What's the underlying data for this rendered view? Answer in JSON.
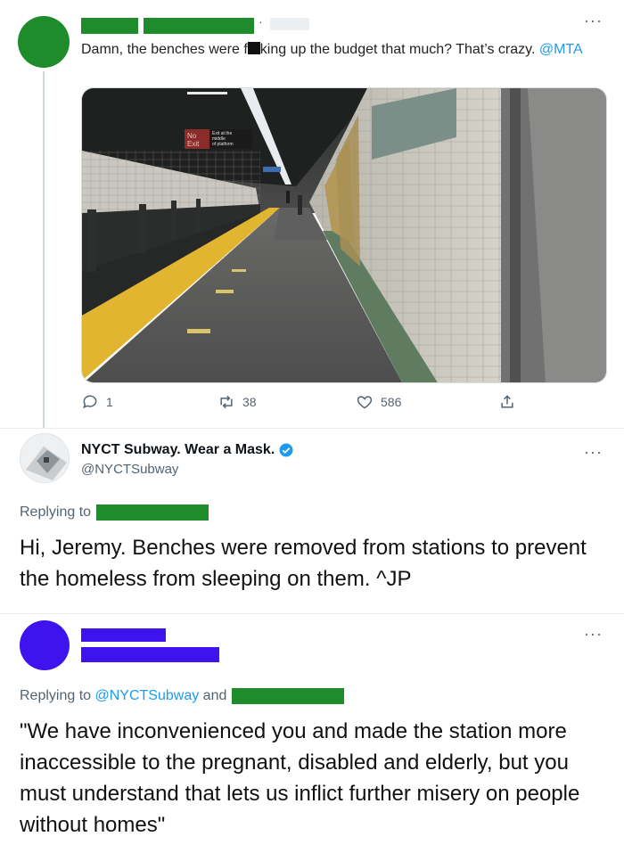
{
  "tweet1": {
    "text_part1": "Damn, the benches were f",
    "text_part2": "king up the budget that much? That’s crazy. ",
    "mention": "@MTA",
    "more": "···",
    "actions": {
      "reply_count": "1",
      "retweet_count": "38",
      "like_count": "586"
    }
  },
  "tweet2": {
    "display_name": "NYCT Subway. Wear a Mask.",
    "handle": "@NYCTSubway",
    "more": "···",
    "replying_label": "Replying to",
    "body": "Hi, Jeremy. Benches were removed from stations to prevent the homeless from sleeping on them. ^JP"
  },
  "tweet3": {
    "more": "···",
    "replying_label": "Replying to",
    "replying_mention": "@NYCTSubway",
    "replying_and": "and",
    "body": "\"We have inconvenienced you and made the station more inaccessible to the pregnant, disabled and elderly, but you must understand that lets us inflict further misery on people without homes\""
  },
  "photo": {
    "sign_line1": "No",
    "sign_line2": "Exit",
    "sign_small1": "Exit at the",
    "sign_small2": "middle",
    "sign_small3": "of platform"
  },
  "colors": {
    "redaction_green": "#1e8c2a",
    "redaction_blue": "#3f13ee",
    "link": "#1d9bf0",
    "verified": "#1d9bf0",
    "muted": "#536471"
  }
}
